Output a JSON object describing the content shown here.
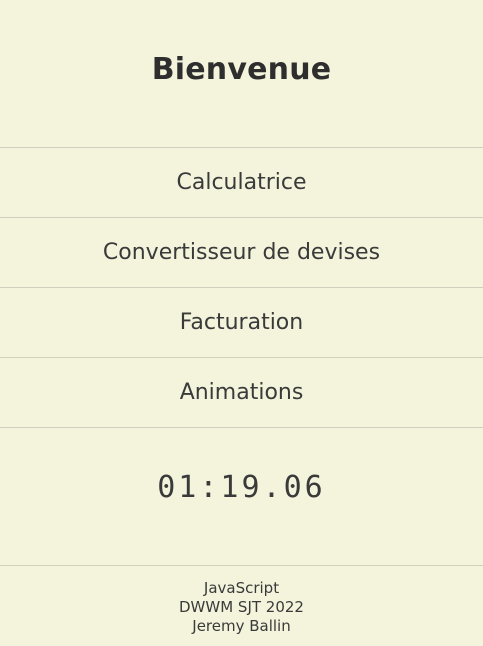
{
  "header": {
    "title": "Bienvenue"
  },
  "nav": {
    "items": [
      {
        "label": "Calculatrice"
      },
      {
        "label": "Convertisseur de devises"
      },
      {
        "label": "Facturation"
      },
      {
        "label": "Animations"
      }
    ]
  },
  "clock": {
    "time": "01:19.06"
  },
  "footer": {
    "line1": "JavaScript",
    "line2": "DWWM SJT 2022",
    "line3": "Jeremy Ballin"
  },
  "colors": {
    "background": "#f4f4dc",
    "text": "#333333",
    "divider": "#cfcfbd"
  }
}
